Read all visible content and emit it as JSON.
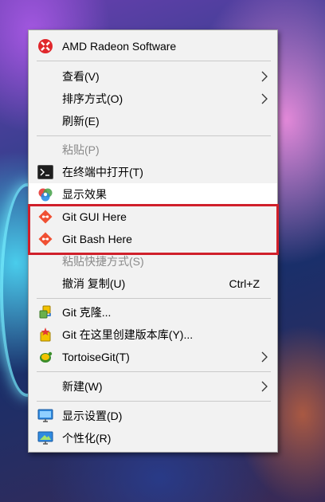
{
  "menu": {
    "items": [
      {
        "label": "AMD Radeon Software",
        "icon": "amd-radeon-icon"
      },
      {
        "label": "查看(V)",
        "submenu": true
      },
      {
        "label": "排序方式(O)",
        "submenu": true
      },
      {
        "label": "刷新(E)"
      },
      {
        "label": "粘贴(P)",
        "disabled": true
      },
      {
        "label": "在终端中打开(T)",
        "icon": "terminal-icon"
      },
      {
        "label": "显示效果",
        "icon": "color-wheel-icon"
      },
      {
        "label": "Git GUI Here",
        "icon": "git-icon"
      },
      {
        "label": "Git Bash Here",
        "icon": "git-icon"
      },
      {
        "label": "粘贴快捷方式(S)",
        "disabled": true
      },
      {
        "label": "撤消 复制(U)",
        "shortcut": "Ctrl+Z"
      },
      {
        "label": "Git 克隆...",
        "icon": "git-clone-icon"
      },
      {
        "label": "Git 在这里创建版本库(Y)...",
        "icon": "git-create-repo-icon"
      },
      {
        "label": "TortoiseGit(T)",
        "icon": "tortoisegit-icon",
        "submenu": true
      },
      {
        "label": "新建(W)",
        "submenu": true
      },
      {
        "label": "显示设置(D)",
        "icon": "display-settings-icon"
      },
      {
        "label": "个性化(R)",
        "icon": "personalize-icon"
      }
    ]
  },
  "colors": {
    "menu_background": "#f2f2f2",
    "hover_background": "#ffffff",
    "highlight_border": "#d0202b",
    "disabled_text": "#8a8a8a",
    "amd_red": "#e0262b",
    "git_orange": "#f05033"
  }
}
